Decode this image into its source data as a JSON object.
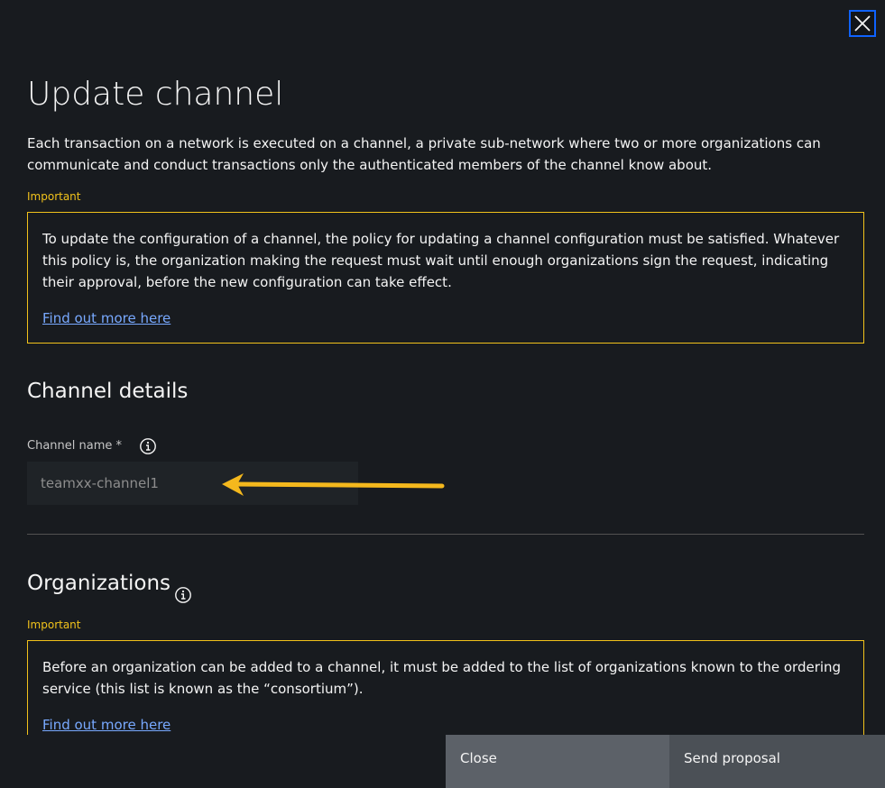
{
  "modal": {
    "title": "Update channel",
    "description": "Each transaction on a network is executed on a channel, a private sub-network where two or more organizations can communicate and conduct transactions only the authenticated members of the channel know about.",
    "close_icon": "close-icon"
  },
  "notice1": {
    "label": "Important",
    "text": "To update the configuration of a channel, the policy for updating a channel configuration must be satisfied. Whatever this policy is, the organization making the request must wait until enough organizations sign the request, indicating their approval, before the new configuration can take effect.",
    "link": "Find out more here"
  },
  "channel_details": {
    "heading": "Channel details",
    "field_label": "Channel name *",
    "field_value": "teamxx-channel1",
    "info_icon": "info-icon"
  },
  "organizations": {
    "heading": "Organizations",
    "info_icon": "info-icon",
    "notice": {
      "label": "Important",
      "text": "Before an organization can be added to a channel, it must be added to the list of organizations known to the ordering service (this list is known as the “consortium”).",
      "link": "Find out more here"
    }
  },
  "footer": {
    "close_label": "Close",
    "send_label": "Send proposal"
  },
  "colors": {
    "background": "#181b1f",
    "accent_warning": "#f1c21b",
    "link": "#78a9ff",
    "focus": "#0f62fe"
  }
}
